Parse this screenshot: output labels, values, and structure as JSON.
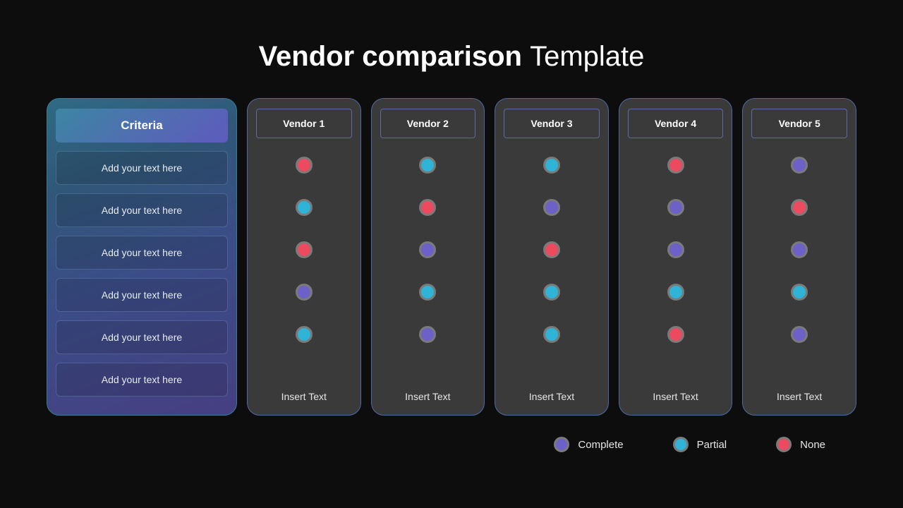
{
  "title_bold": "Vendor comparison",
  "title_light": "Template",
  "criteria": {
    "header": "Criteria",
    "items": [
      "Add your text here",
      "Add your text here",
      "Add your text here",
      "Add your text here",
      "Add your text here",
      "Add your text here"
    ]
  },
  "vendors": [
    {
      "name": "Vendor 1",
      "dots": [
        "none",
        "partial",
        "none",
        "complete",
        "partial"
      ],
      "footer": "Insert Text"
    },
    {
      "name": "Vendor 2",
      "dots": [
        "partial",
        "none",
        "complete",
        "partial",
        "complete"
      ],
      "footer": "Insert Text"
    },
    {
      "name": "Vendor 3",
      "dots": [
        "partial",
        "complete",
        "none",
        "partial",
        "partial"
      ],
      "footer": "Insert Text"
    },
    {
      "name": "Vendor 4",
      "dots": [
        "none",
        "complete",
        "complete",
        "partial",
        "none"
      ],
      "footer": "Insert Text"
    },
    {
      "name": "Vendor 5",
      "dots": [
        "complete",
        "none",
        "complete",
        "partial",
        "complete"
      ],
      "footer": "Insert Text"
    }
  ],
  "legend": [
    {
      "status": "complete",
      "label": "Complete"
    },
    {
      "status": "partial",
      "label": "Partial"
    },
    {
      "status": "none",
      "label": "None"
    }
  ]
}
